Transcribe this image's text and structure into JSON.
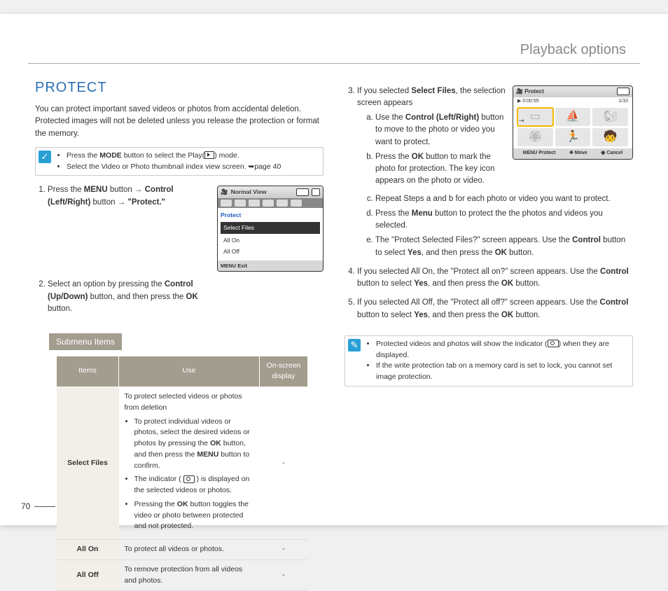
{
  "header": {
    "title": "Playback options"
  },
  "section": {
    "title": "PROTECT"
  },
  "intro": "You can protect important saved videos or photos from accidental deletion. Protected images will not be deleted unless you release the protection or format the memory.",
  "note1": {
    "b1a": "Press the ",
    "b1b": "MODE",
    "b1c": " button to select the Play(",
    "b1d": ") mode.",
    "b2": "Select the Video or Photo thumbnail index view screen. ➥page 40"
  },
  "step1": {
    "a": "Press the ",
    "b": "MENU",
    "c": " button ",
    "arrow": "→",
    "d": " Control (Left/Right)",
    "e": " button ",
    "f": "\"Protect.\""
  },
  "step2": {
    "a": "Select an option by pressing the ",
    "b": "Control (Up/Down)",
    "c": " button, and then press the ",
    "d": "OK",
    "e": " button."
  },
  "screen1": {
    "topLabel": "Normal View",
    "protect": "Protect",
    "selectFiles": "Select Files",
    "allOn": "All On",
    "allOff": "All Off",
    "menuPrefix": "MENU",
    "exit": "Exit"
  },
  "submenu": {
    "label": "Submenu Items",
    "th1": "Items",
    "th2": "Use",
    "th3": "On-screen display",
    "r1": {
      "item": "Select Files",
      "lead": "To protect selected videos or photos from deletion",
      "li1a": "To protect individual videos or photos, select the desired videos or photos by pressing the ",
      "li1b": "OK",
      "li1c": " button, and then press the ",
      "li1d": "MENU",
      "li1e": " button to confirm.",
      "li2a": "The indicator ( ",
      "li2b": " ) is displayed on the selected videos or photos.",
      "li3a": "Pressing the ",
      "li3b": "OK",
      "li3c": " button toggles the video or photo between protected and not protected.",
      "disp": "-"
    },
    "r2": {
      "item": "All On",
      "use": "To protect all videos or photos.",
      "disp": "-"
    },
    "r3": {
      "item": "All Off",
      "use": "To remove protection from all videos and photos.",
      "disp": "-"
    }
  },
  "step3": {
    "a": "If you selected ",
    "b": "Select Files",
    "c": ", the selection screen appears",
    "sa1": "Use the ",
    "sa2": "Control (Left/Right)",
    "sa3": " button to move to the photo or video you want to protect.",
    "sb1": "Press the ",
    "sb2": "OK",
    "sb3": " button to mark the photo for protection. The key icon appears on the photo or video.",
    "sc": "Repeat Steps a and b for each photo or video you want to protect.",
    "sd1": "Press the ",
    "sd2": "Menu",
    "sd3": " button to protect the the photos and videos you selected.",
    "se1": "The \"Protect Selected Files?\" screen appears. Use the ",
    "se2": "Control",
    "se3": " button to select ",
    "se4": "Yes",
    "se5": ", and then press the ",
    "se6": "OK",
    "se7": " button."
  },
  "step4": {
    "a": "If you selected All On, the \"Protect all on?\" screen appears. Use the ",
    "b": "Control",
    "c": " button to select ",
    "d": "Yes",
    "e": ", and then press the ",
    "f": "OK",
    "g": " button."
  },
  "step5": {
    "a": "If you selected All Off, the \"Protect all off?\" screen appears. Use the ",
    "b": "Control",
    "c": " button to select ",
    "d": "Yes",
    "e": ", and then press the ",
    "f": "OK",
    "g": " button."
  },
  "screen2": {
    "title": "Protect",
    "time": "0:00:55",
    "counter": "1/10",
    "f1p": "MENU",
    "f1": "Protect",
    "f2": "Move",
    "f3": "Cancel"
  },
  "note2": {
    "b1a": "Protected videos and photos will show the indicator (",
    "b1b": ") when they are displayed.",
    "b2": "If the write protection tab on a memory card is set to lock, you cannot set image protection."
  },
  "pageNum": "70"
}
